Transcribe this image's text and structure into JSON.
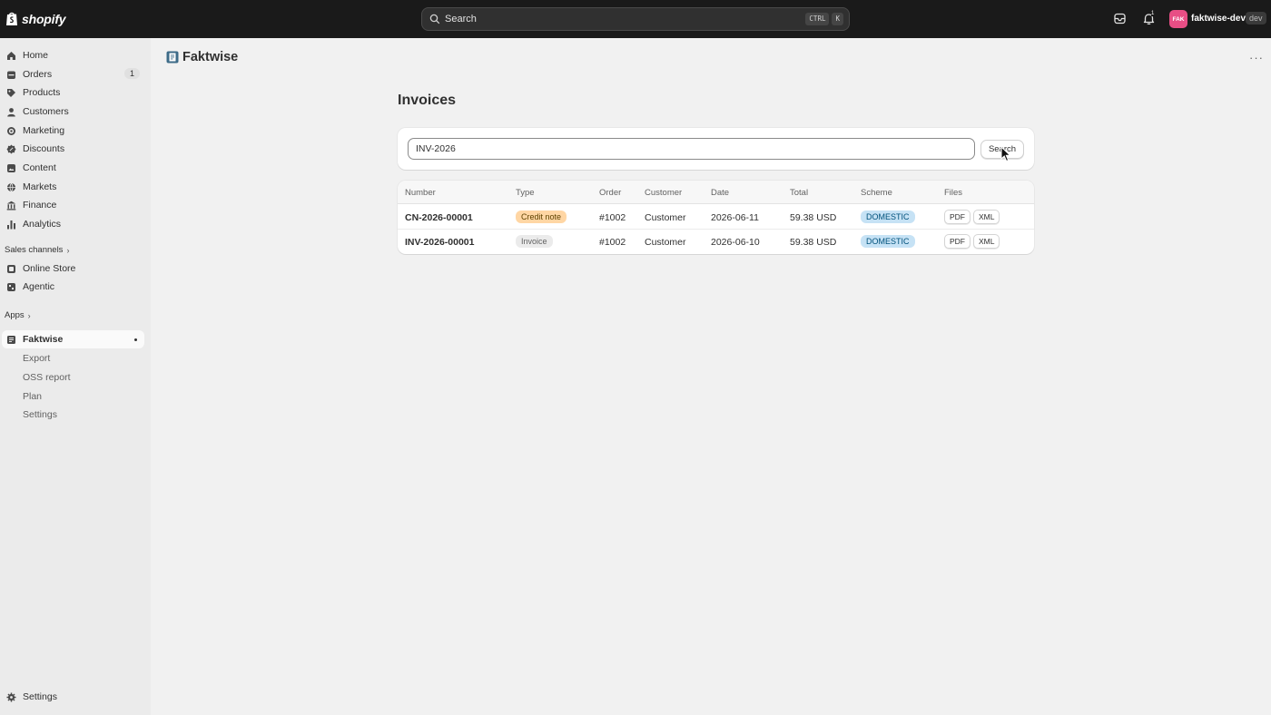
{
  "topbar": {
    "brand": "shopify",
    "search_label": "Search",
    "shortcut_ctrl": "CTRL",
    "shortcut_key": "K",
    "notification_count": "1",
    "store_initials": "FAK",
    "store_name": "faktwise-dev",
    "store_tag": "dev"
  },
  "sidebar": {
    "items": [
      {
        "label": "Home",
        "icon": "home-icon"
      },
      {
        "label": "Orders",
        "icon": "orders-icon",
        "badge": "1"
      },
      {
        "label": "Products",
        "icon": "tag-icon"
      },
      {
        "label": "Customers",
        "icon": "person-icon"
      },
      {
        "label": "Marketing",
        "icon": "target-icon"
      },
      {
        "label": "Discounts",
        "icon": "discount-icon"
      },
      {
        "label": "Content",
        "icon": "content-icon"
      },
      {
        "label": "Markets",
        "icon": "globe-icon"
      },
      {
        "label": "Finance",
        "icon": "bank-icon"
      },
      {
        "label": "Analytics",
        "icon": "chart-icon"
      }
    ],
    "sales_channels_label": "Sales channels",
    "channels": [
      {
        "label": "Online Store",
        "icon": "store-icon"
      },
      {
        "label": "Agentic",
        "icon": "agentic-icon"
      }
    ],
    "apps_label": "Apps",
    "app": {
      "label": "Faktwise",
      "icon": "faktwise-icon"
    },
    "app_subitems": [
      "Export",
      "OSS report",
      "Plan",
      "Settings"
    ],
    "settings_label": "Settings"
  },
  "main": {
    "app_title": "Faktwise",
    "more_label": "···",
    "page_heading": "Invoices",
    "search_value": "INV-2026",
    "search_button": "Search",
    "columns": [
      "Number",
      "Type",
      "Order",
      "Customer",
      "Date",
      "Total",
      "Scheme",
      "Files"
    ],
    "rows": [
      {
        "number": "CN-2026-00001",
        "type": "Credit note",
        "order": "#1002",
        "customer": "Customer",
        "date": "2026-06-11",
        "total": "59.38 USD",
        "scheme": "DOMESTIC",
        "pdf": "PDF",
        "xml": "XML"
      },
      {
        "number": "INV-2026-00001",
        "type": "Invoice",
        "order": "#1002",
        "customer": "Customer",
        "date": "2026-06-10",
        "total": "59.38 USD",
        "scheme": "DOMESTIC",
        "pdf": "PDF",
        "xml": "XML"
      }
    ]
  },
  "colors": {
    "topbar": "#1a1a1a",
    "credit_note_pill": "#ffd6a4",
    "scheme_pill": "#c6e2f5",
    "avatar": "#e84e85"
  }
}
